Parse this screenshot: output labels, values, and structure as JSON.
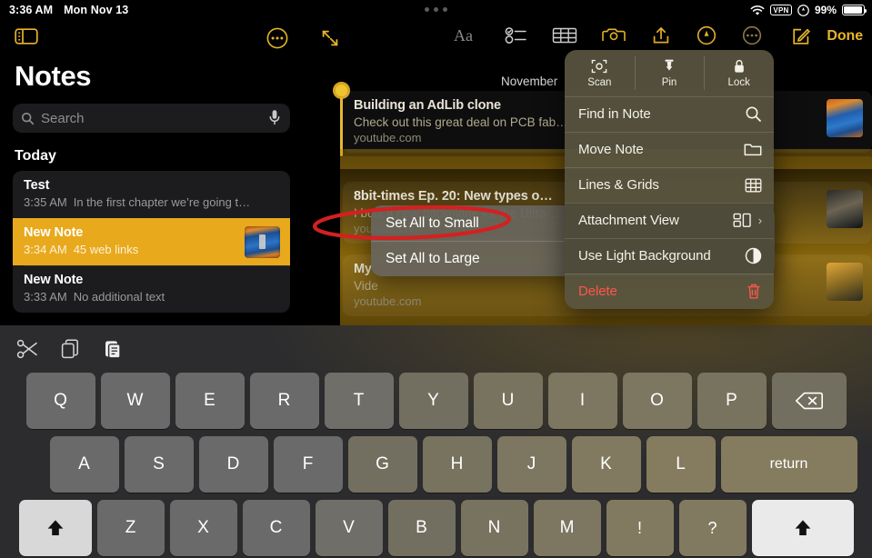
{
  "statusbar": {
    "time": "3:36 AM",
    "date": "Mon Nov 13",
    "wifi_icon": "wifi-icon",
    "vpn_label": "VPN",
    "location_icon": "location-arrow-icon",
    "battery_percent": "99%",
    "battery_icon": "battery-icon"
  },
  "sidebar": {
    "sidebar_toggle_icon": "sidebar-toggle-icon",
    "more_icon": "ellipsis-circle-icon",
    "title": "Notes",
    "search": {
      "placeholder": "Search",
      "search_icon": "search-icon",
      "mic_icon": "microphone-icon"
    },
    "section_header": "Today",
    "notes": [
      {
        "title": "Test",
        "time": "3:35 AM",
        "preview": "In the first chapter we’re going t…",
        "selected": false,
        "has_thumbnail": false
      },
      {
        "title": "New Note",
        "time": "3:34 AM",
        "preview": "45 web links",
        "selected": true,
        "has_thumbnail": true
      },
      {
        "title": "New Note",
        "time": "3:33 AM",
        "preview": "No additional text",
        "selected": false,
        "has_thumbnail": false
      }
    ]
  },
  "editor": {
    "expand_icon": "expand-arrows-icon",
    "format_icon": "aa-format-icon",
    "checklist_icon": "checklist-icon",
    "table_icon": "table-icon",
    "camera_icon": "camera-icon",
    "share_icon": "share-up-icon",
    "markup_icon": "markup-pen-icon",
    "more_icon": "ellipsis-circle-icon",
    "compose_icon": "compose-square-icon",
    "done_label": "Done",
    "date_label": "November",
    "link_cards": [
      {
        "title": "Building an AdLib clone",
        "subtitle": "Check out this great deal on PCB fab…",
        "url": "youtube.com"
      },
      {
        "title": "8bit-times Ep. 20: New types o…",
        "subtitle": "I built a new backplane for the Ultra-…",
        "url": "youtube.com"
      },
      {
        "title": "My",
        "subtitle": "Vide",
        "url": "youtube.com"
      }
    ],
    "selection_handle": "selection-handle"
  },
  "context_menu": {
    "top_actions": [
      {
        "label": "Scan",
        "icon": "document-scan-icon"
      },
      {
        "label": "Pin",
        "icon": "pin-icon"
      },
      {
        "label": "Lock",
        "icon": "lock-icon"
      }
    ],
    "items": [
      {
        "label": "Find in Note",
        "icon": "search-icon",
        "danger": false,
        "submenu": false,
        "highlight": false
      },
      {
        "label": "Move Note",
        "icon": "folder-icon",
        "danger": false,
        "submenu": false,
        "highlight": false
      },
      {
        "label": "Lines & Grids",
        "icon": "grid-icon",
        "danger": false,
        "submenu": false,
        "highlight": false
      },
      {
        "label": "Attachment View",
        "icon": "attachment-view-icon",
        "danger": false,
        "submenu": true,
        "highlight": true
      },
      {
        "label": "Use Light Background",
        "icon": "half-circle-icon",
        "danger": false,
        "submenu": false,
        "highlight": true
      },
      {
        "label": "Delete",
        "icon": "trash-icon",
        "danger": true,
        "submenu": false,
        "highlight": false
      }
    ],
    "chevron": "›"
  },
  "submenu": {
    "items": [
      {
        "label": "Set All to Small"
      },
      {
        "label": "Set All to Large"
      }
    ]
  },
  "annotation": {
    "shape": "red-ellipse",
    "color": "#d42020",
    "targets": "Set All to Small"
  },
  "keyboard": {
    "assist": [
      {
        "icon": "cut-scissors-icon"
      },
      {
        "icon": "copy-icon"
      },
      {
        "icon": "paste-icon"
      }
    ],
    "row1": [
      "Q",
      "W",
      "E",
      "R",
      "T",
      "Y",
      "U",
      "I",
      "O",
      "P"
    ],
    "row1_action": {
      "label": "",
      "icon": "delete-backspace-icon"
    },
    "row2": [
      "A",
      "S",
      "D",
      "F",
      "G",
      "H",
      "J",
      "K",
      "L"
    ],
    "row2_action": {
      "label": "return"
    },
    "row3_left": {
      "icon": "shift-up-arrow-icon"
    },
    "row3": [
      "Z",
      "X",
      "C",
      "V",
      "B",
      "N",
      "M",
      "!",
      "?"
    ],
    "row3_right": {
      "icon": "shift-up-arrow-icon"
    }
  },
  "colors": {
    "accent_yellow": "#e8b429",
    "selected_row": "#e8a91d",
    "danger_red": "#ff564a",
    "annotation_red": "#d42020",
    "keyboard_bg": "#2c2c2e",
    "key_gray": "#707070"
  }
}
